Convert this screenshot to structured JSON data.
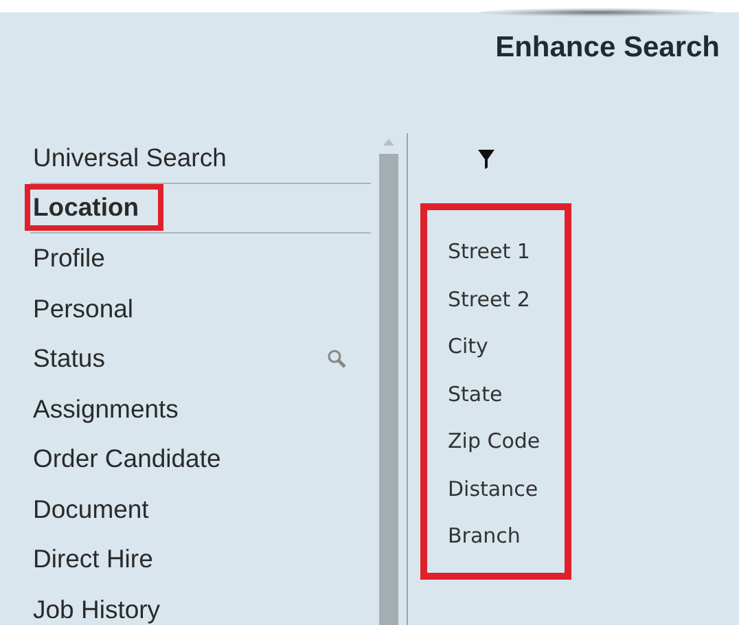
{
  "title": "Enhance Search",
  "sidebar": {
    "items": [
      {
        "label": "Universal Search",
        "selected": false,
        "search_icon": false
      },
      {
        "label": "Location",
        "selected": true,
        "search_icon": false
      },
      {
        "label": "Profile",
        "selected": false,
        "search_icon": false
      },
      {
        "label": "Personal",
        "selected": false,
        "search_icon": false
      },
      {
        "label": "Status",
        "selected": false,
        "search_icon": true
      },
      {
        "label": "Assignments",
        "selected": false,
        "search_icon": false
      },
      {
        "label": "Order Candidate",
        "selected": false,
        "search_icon": false
      },
      {
        "label": "Document",
        "selected": false,
        "search_icon": false
      },
      {
        "label": "Direct Hire",
        "selected": false,
        "search_icon": false
      },
      {
        "label": "Job History",
        "selected": false,
        "search_icon": false
      }
    ]
  },
  "fields": [
    "Street 1",
    "Street 2",
    "City",
    "State",
    "Zip Code",
    "Distance",
    "Branch"
  ]
}
